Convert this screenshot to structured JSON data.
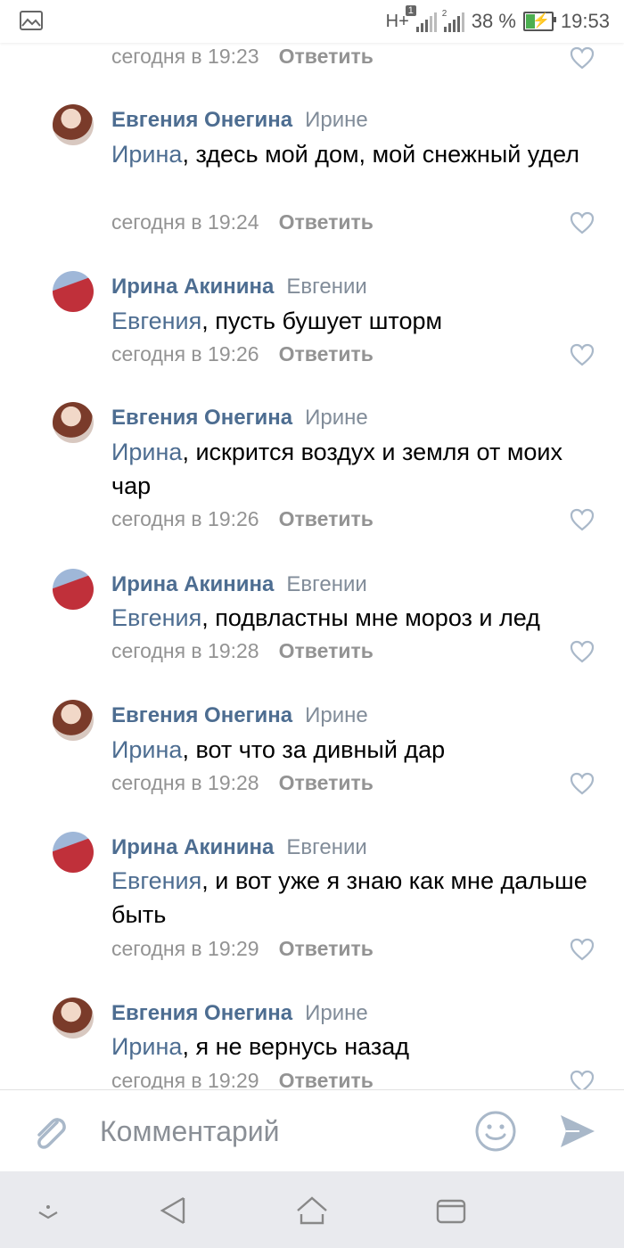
{
  "status_bar": {
    "network": "H+",
    "sim1_badge": "1",
    "sim2_badge": "2",
    "battery": "38 %",
    "battery_level": 0.38,
    "time": "19:53"
  },
  "comments": [
    {
      "meta": {
        "time": "сегодня в 19:23",
        "reply": "Ответить"
      }
    },
    {
      "author": "Евгения Онегина",
      "to": "Ирине",
      "mention": "Ирина",
      "text": ", здесь мой дом, мой снежный удел",
      "meta": {
        "time": "сегодня в 19:24",
        "reply": "Ответить"
      }
    },
    {
      "author": "Ирина Акинина",
      "to": "Евгении",
      "mention": "Евгения",
      "text": ", пусть бушует шторм",
      "meta": {
        "time": "сегодня в 19:26",
        "reply": "Ответить"
      }
    },
    {
      "author": "Евгения Онегина",
      "to": "Ирине",
      "mention": "Ирина",
      "text": ", искрится воздух и земля от моих чар",
      "meta": {
        "time": "сегодня в 19:26",
        "reply": "Ответить"
      }
    },
    {
      "author": "Ирина Акинина",
      "to": "Евгении",
      "mention": "Евгения",
      "text": ", подвластны мне мороз и лед",
      "meta": {
        "time": "сегодня в 19:28",
        "reply": "Ответить"
      }
    },
    {
      "author": "Евгения Онегина",
      "to": "Ирине",
      "mention": "Ирина",
      "text": ", вот что за дивный дар",
      "meta": {
        "time": "сегодня в 19:28",
        "reply": "Ответить"
      }
    },
    {
      "author": "Ирина Акинина",
      "to": "Евгении",
      "mention": "Евгения",
      "text": ", и вот уже я знаю как мне дальше быть",
      "meta": {
        "time": "сегодня в 19:29",
        "reply": "Ответить"
      }
    },
    {
      "author": "Евгения Онегина",
      "to": "Ирине",
      "mention": "Ирина",
      "text": ", я не вернусь назад",
      "meta": {
        "time": "сегодня в 19:29",
        "reply": "Ответить"
      }
    }
  ],
  "input": {
    "placeholder": "Комментарий",
    "icons": [
      "paperclip-icon",
      "emoji-icon",
      "send-icon"
    ]
  },
  "navigation": {
    "icons": [
      "chevron-down-icon",
      "back-icon",
      "home-icon",
      "recents-icon"
    ]
  },
  "colors": {
    "link": "#4d6d91",
    "secondary_text": "#939393",
    "icon": "#a9b8c9"
  }
}
